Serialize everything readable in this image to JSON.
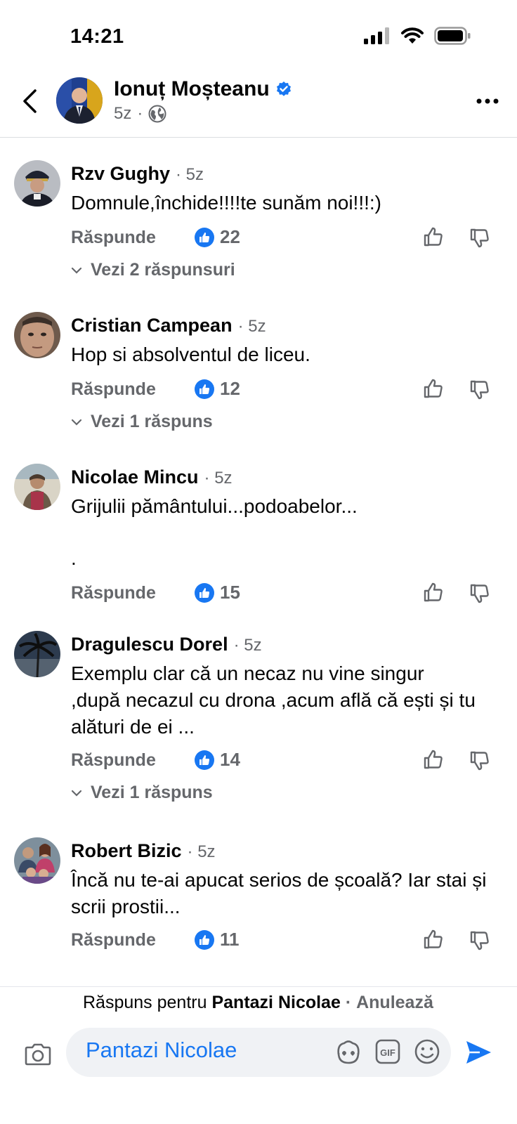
{
  "status_bar": {
    "time": "14:21"
  },
  "header": {
    "name": "Ionuț Moșteanu",
    "time": "5z",
    "separator": "·"
  },
  "comments": [
    {
      "author": "Rzv Gughy",
      "time": "· 5z",
      "text": "Domnule,închide!!!!te sunăm noi!!!:)",
      "reply_label": "Răspunde",
      "likes": "22",
      "view_replies": "Vezi 2 răspunsuri"
    },
    {
      "author": "Cristian Campean",
      "time": "· 5z",
      "text": "Hop si absolventul de liceu.",
      "reply_label": "Răspunde",
      "likes": "12",
      "view_replies": "Vezi 1 răspuns"
    },
    {
      "author": "Nicolae Mincu",
      "time": "· 5z",
      "text": "Grijulii pământului...podoabelor...",
      "text2": ".",
      "reply_label": "Răspunde",
      "likes": "15"
    },
    {
      "author": "Dragulescu Dorel",
      "time": "· 5z",
      "text": "Exemplu clar  că un necaz nu vine singur ,după necazul cu drona ,acum află că ești și tu alături de ei ...",
      "reply_label": "Răspunde",
      "likes": "14",
      "view_replies": "Vezi 1 răspuns"
    },
    {
      "author": "Robert Bizic",
      "time": "· 5z",
      "text": "Încă nu te-ai apucat serios de școală? Iar stai și scrii prostii...",
      "reply_label": "Răspunde",
      "likes": "11"
    }
  ],
  "reply_bar": {
    "replying_prefix": "Răspuns pentru",
    "replying_to": "Pantazi Nicolae",
    "cancel_sep": "·",
    "cancel_label": "Anulează",
    "input_value": "Pantazi Nicolae"
  },
  "colors": {
    "accent": "#1877f2",
    "secondary_text": "#65676b",
    "input_bg": "#f0f2f5"
  }
}
